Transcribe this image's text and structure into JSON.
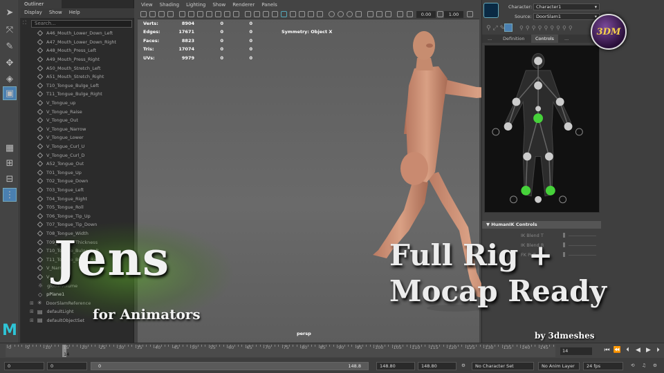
{
  "outliner": {
    "tab": "Outliner",
    "menu": [
      "Display",
      "Show",
      "Help"
    ],
    "search_placeholder": "Search...",
    "items": [
      {
        "label": "A46_Mouth_Lower_Down_Left",
        "type": "shape"
      },
      {
        "label": "A47_Mouth_Lower_Down_Right",
        "type": "shape"
      },
      {
        "label": "A48_Mouth_Press_Left",
        "type": "shape"
      },
      {
        "label": "A49_Mouth_Press_Right",
        "type": "shape"
      },
      {
        "label": "A50_Mouth_Stretch_Left",
        "type": "shape"
      },
      {
        "label": "A51_Mouth_Stretch_Right",
        "type": "shape"
      },
      {
        "label": "T10_Tongue_Bulge_Left",
        "type": "shape"
      },
      {
        "label": "T11_Tongue_Bulge_Right",
        "type": "shape"
      },
      {
        "label": "V_Tongue_up",
        "type": "shape"
      },
      {
        "label": "V_Tongue_Raise",
        "type": "shape"
      },
      {
        "label": "V_Tongue_Out",
        "type": "shape"
      },
      {
        "label": "V_Tongue_Narrow",
        "type": "shape"
      },
      {
        "label": "V_Tongue_Lower",
        "type": "shape"
      },
      {
        "label": "V_Tongue_Curl_U",
        "type": "shape"
      },
      {
        "label": "V_Tongue_Curl_D",
        "type": "shape"
      },
      {
        "label": "A52_Tongue_Out",
        "type": "shape"
      },
      {
        "label": "T01_Tongue_Up",
        "type": "shape"
      },
      {
        "label": "T02_Tongue_Down",
        "type": "shape"
      },
      {
        "label": "T03_Tongue_Left",
        "type": "shape"
      },
      {
        "label": "T04_Tongue_Right",
        "type": "shape"
      },
      {
        "label": "T05_Tongue_Roll",
        "type": "shape"
      },
      {
        "label": "T06_Tongue_Tip_Up",
        "type": "shape"
      },
      {
        "label": "T07_Tongue_Tip_Down",
        "type": "shape"
      },
      {
        "label": "T08_Tongue_Width",
        "type": "shape"
      },
      {
        "label": "T09_Tongue_Thickness",
        "type": "shape"
      },
      {
        "label": "T10_Tongue_Bulge_Left",
        "type": "shape"
      },
      {
        "label": "T11_Tongue_Bulge_Right",
        "type": "shape"
      },
      {
        "label": "V_Narrow",
        "type": "shape"
      },
      {
        "label": "V_",
        "type": "shape"
      },
      {
        "label": "globalVolume",
        "type": "light"
      },
      {
        "label": "pPlane1",
        "type": "mesh"
      },
      {
        "label": "DoorSlamReference",
        "type": "reference"
      },
      {
        "label": "defaultLight",
        "type": "set"
      },
      {
        "label": "defaultObjectSet",
        "type": "set"
      }
    ]
  },
  "viewport": {
    "menu": [
      "View",
      "Shading",
      "Lighting",
      "Show",
      "Renderer",
      "Panels"
    ],
    "field_a": "0.00",
    "field_b": "1.00",
    "hud": [
      {
        "label": "Verts:",
        "v1": "8904",
        "v2": "0",
        "v3": "0"
      },
      {
        "label": "Edges:",
        "v1": "17671",
        "v2": "0",
        "v3": "0"
      },
      {
        "label": "Faces:",
        "v1": "8823",
        "v2": "0",
        "v3": "0"
      },
      {
        "label": "Tris:",
        "v1": "17074",
        "v2": "0",
        "v3": "0"
      },
      {
        "label": "UVs:",
        "v1": "9979",
        "v2": "0",
        "v3": "0"
      }
    ],
    "symmetry": "Symmetry: Object X",
    "camera": "persp"
  },
  "humanik": {
    "character_label": "Character:",
    "character_value": "Character1",
    "source_label": "Source:",
    "source_value": "DoorSlam1",
    "tabs": [
      "...",
      "Definition",
      "Controls",
      "..."
    ],
    "section": "HumanIK Controls",
    "ik_rows": [
      "IK Blend T",
      "IK Blend R",
      "FK Pull"
    ]
  },
  "badge": "3DM",
  "overlay": {
    "title": "Jens",
    "subtitle": "for Animators",
    "headline_1": "Full Rig +",
    "headline_2": "Mocap Ready",
    "byline": "by 3dmeshes"
  },
  "timeline": {
    "ticks": [
      "0",
      "5",
      "10",
      "15",
      "20",
      "25",
      "30",
      "35",
      "40",
      "45",
      "50",
      "55",
      "60",
      "65",
      "70",
      "75",
      "80",
      "85",
      "90",
      "95",
      "100",
      "105",
      "110",
      "115",
      "120",
      "125",
      "130",
      "135",
      "140",
      "145"
    ],
    "current_frame": "14",
    "frame_field": "14"
  },
  "range": {
    "start": "0",
    "anim_start": "0",
    "slider_start": "0",
    "slider_end": "148.8",
    "range_end": "148.80",
    "anim_end": "148.80",
    "character_set": "No Character Set",
    "anim_layer": "No Anim Layer",
    "fps": "24 fps"
  },
  "colors": {
    "accent": "#4a7fb0",
    "effector_green": "#46d23a",
    "maya_teal": "#2ec4d6",
    "badge_gold": "#f6d24a"
  }
}
